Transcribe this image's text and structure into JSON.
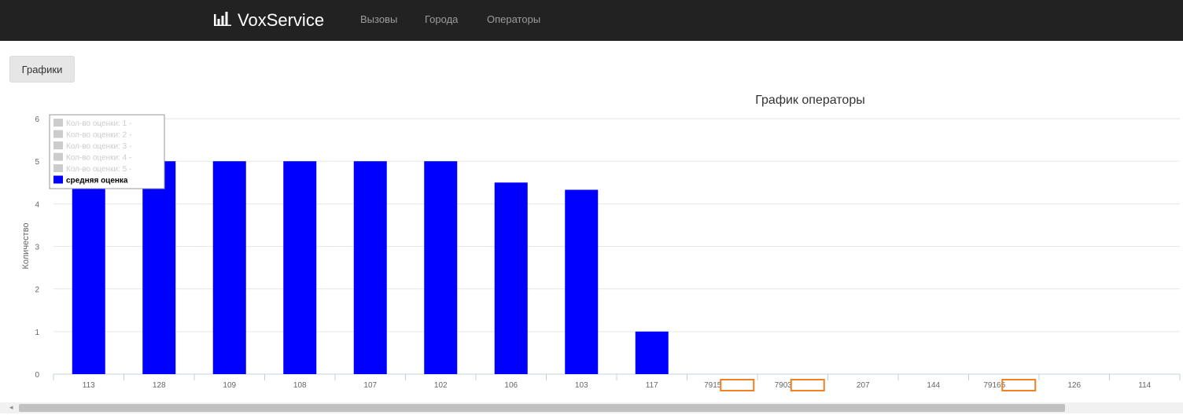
{
  "nav": {
    "brand": "VoxService",
    "brand_icon": "bar-chart-icon",
    "links": [
      "Вызовы",
      "Города",
      "Операторы"
    ]
  },
  "toolbar": {
    "charts_button": "Графики"
  },
  "colors": {
    "navbar_bg": "#222222",
    "bar": "#0000ff",
    "legend_inactive": "#cccccc",
    "highlight_box": "#f08020",
    "grid": "#e6e6e6"
  },
  "chart_data": {
    "type": "bar",
    "title": "График операторы",
    "xlabel": "",
    "ylabel": "Количество",
    "ylim": [
      0,
      6
    ],
    "yticks": [
      0,
      1,
      2,
      3,
      4,
      5,
      6
    ],
    "grid": true,
    "legend_position": "top-left",
    "categories": [
      "113",
      "128",
      "109",
      "108",
      "107",
      "102",
      "106",
      "103",
      "117",
      "7915",
      "7903",
      "207",
      "144",
      "79165",
      "126",
      "114"
    ],
    "highlighted_categories": [
      "7915",
      "7903",
      "79165"
    ],
    "series": [
      {
        "name": "Кол-во оценки: 1 -",
        "visible": false,
        "values": []
      },
      {
        "name": "Кол-во оценки: 2 -",
        "visible": false,
        "values": []
      },
      {
        "name": "Кол-во оценки: 3 -",
        "visible": false,
        "values": []
      },
      {
        "name": "Кол-во оценки: 4 -",
        "visible": false,
        "values": []
      },
      {
        "name": "Кол-во оценки: 5 -",
        "visible": false,
        "values": []
      },
      {
        "name": "средняя оценка",
        "visible": true,
        "values": [
          5,
          5,
          5,
          5,
          5,
          5,
          4.5,
          4.33,
          1,
          0,
          0,
          0,
          0,
          0,
          0,
          0
        ]
      }
    ]
  }
}
